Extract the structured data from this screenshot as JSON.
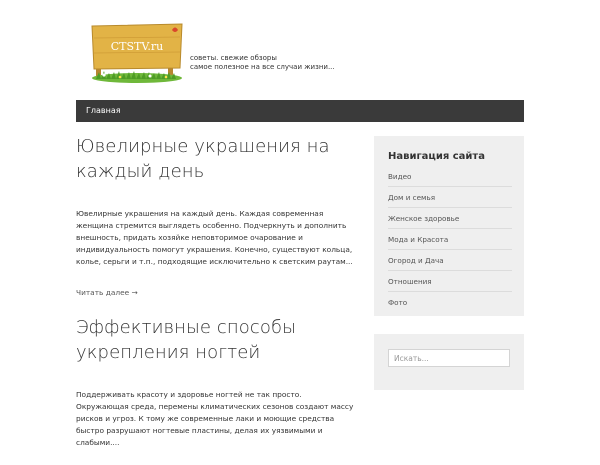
{
  "site": {
    "logo_text": "CTSTV.ru",
    "tagline_line1": "советы. свежие обзоры",
    "tagline_line2": "самое полезное на все случаи жизни..."
  },
  "nav": {
    "items": [
      {
        "label": "Главная"
      }
    ]
  },
  "posts": [
    {
      "title": "Ювелирные украшения на каждый день",
      "excerpt": "Ювелирные украшения на каждый день. Каждая современная женщина стремится выглядеть особенно. Подчеркнуть и дополнить внешность, придать хозяйке неповторимое очарование и индивидуальность помогут украшения. Конечно, существуют кольца, колье, серьги и т.п., подходящие исключительно к светским раутам...",
      "read_more": "Читать далее →"
    },
    {
      "title": "Эффективные способы укрепления ногтей",
      "excerpt": "Поддерживать красоту и здоровье ногтей не так просто. Окружающая среда, перемены климатических сезонов создают массу рисков и угроз. К тому же современные лаки и моющие средства быстро разрушают ногтевые пластины, делая их уязвимыми и слабыми...."
    }
  ],
  "sidebar": {
    "title": "Навигация сайта",
    "items": [
      {
        "label": "Видео"
      },
      {
        "label": "Дом и семья"
      },
      {
        "label": "Женское здоровье"
      },
      {
        "label": "Мода и Красота"
      },
      {
        "label": "Огород и Дача"
      },
      {
        "label": "Отношения"
      },
      {
        "label": "Фото"
      }
    ]
  },
  "search": {
    "placeholder": "Искать..."
  },
  "colors": {
    "navbar": "#3a3a3a",
    "sidebar_bg": "#efefef",
    "sign_wood": "#e2b346",
    "grass": "#6fb83a"
  }
}
